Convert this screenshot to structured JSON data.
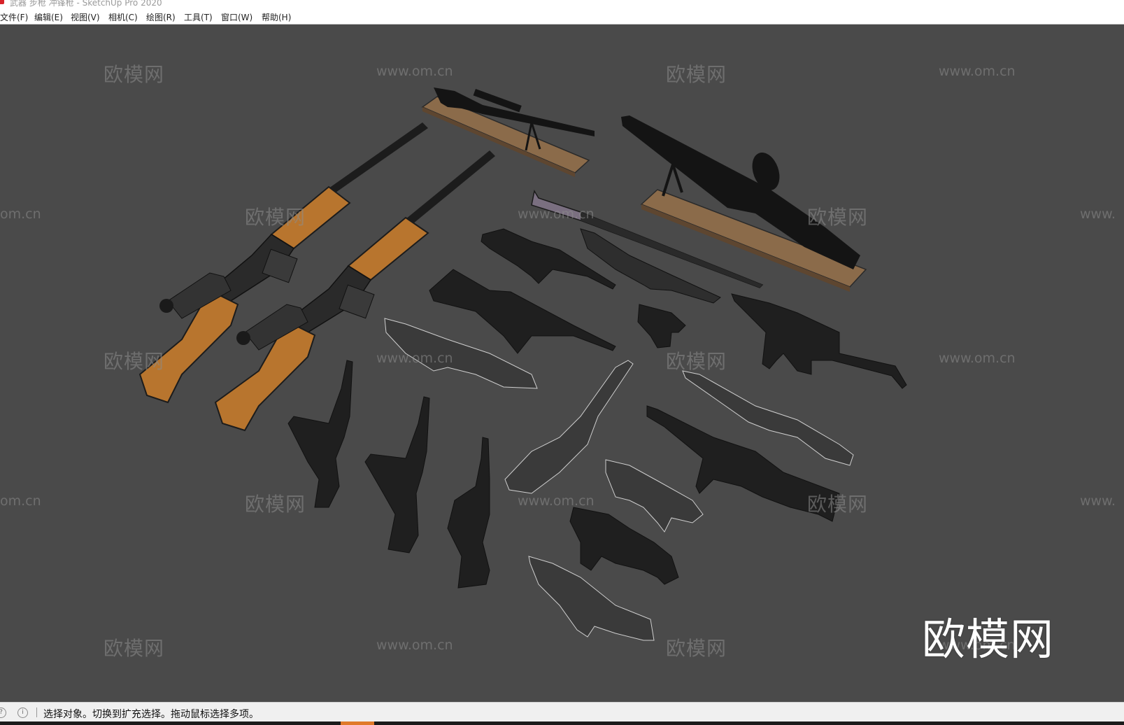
{
  "window": {
    "title": "武器 步枪 冲锋枪 - SketchUp Pro 2020"
  },
  "menu": {
    "items": [
      {
        "id": "file",
        "label": "文件(F)"
      },
      {
        "id": "edit",
        "label": "编辑(E)"
      },
      {
        "id": "view",
        "label": "视图(V)"
      },
      {
        "id": "camera",
        "label": "相机(C)"
      },
      {
        "id": "draw",
        "label": "绘图(R)"
      },
      {
        "id": "tools",
        "label": "工具(T)"
      },
      {
        "id": "window",
        "label": "窗口(W)"
      },
      {
        "id": "help",
        "label": "帮助(H)"
      }
    ]
  },
  "watermark": {
    "brand": "欧模网",
    "url": "www.om.cn",
    "url_short": "om.cn",
    "url_prefix": "www.",
    "partial_brand": "欧模网"
  },
  "big_logo": "欧模网",
  "statusbar": {
    "text": "选择对象。切换到扩充选择。拖动鼠标选择多项。",
    "icons": [
      "geo-location-icon",
      "info-icon"
    ]
  },
  "colors": {
    "viewport_bg": "#4a4a4a",
    "wood": "#b8752e",
    "metal": "#2b2b2b",
    "plank": "#8a6a48"
  }
}
